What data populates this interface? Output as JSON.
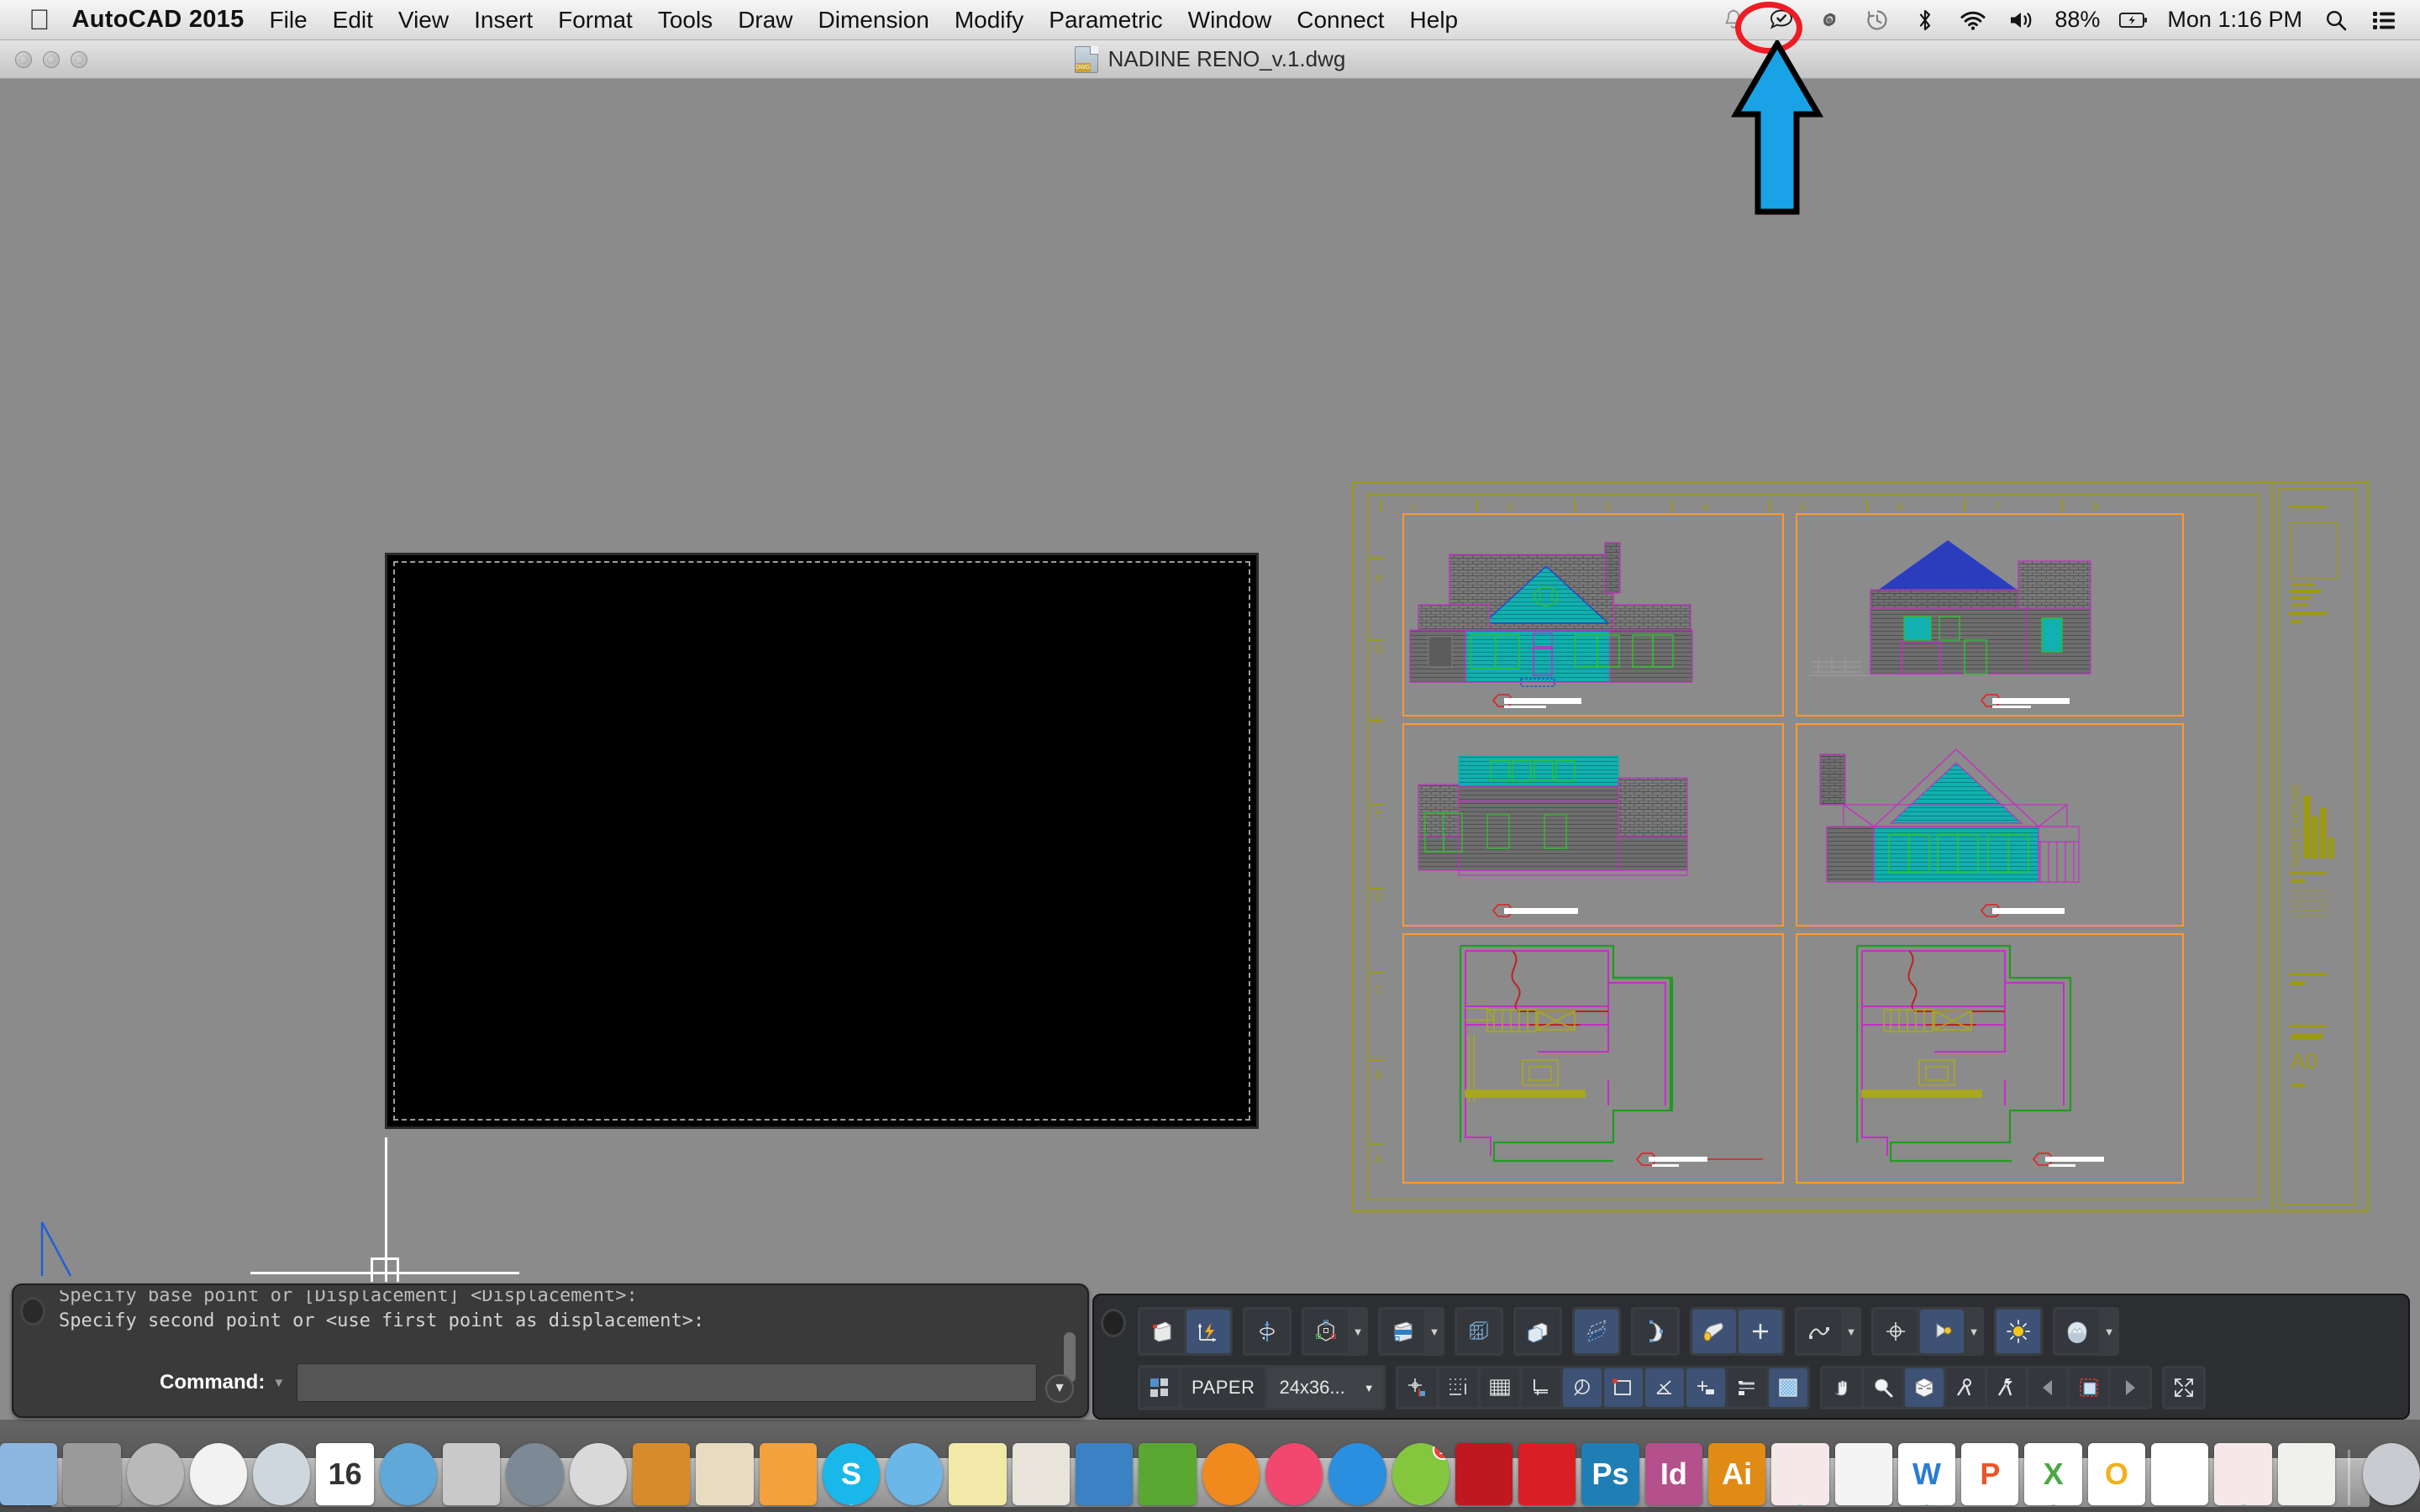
{
  "menubar": {
    "apple_icon": "apple-logo-icon",
    "app_name": "AutoCAD 2015",
    "menus": [
      "File",
      "Edit",
      "View",
      "Insert",
      "Format",
      "Tools",
      "Draw",
      "Dimension",
      "Modify",
      "Parametric",
      "Window",
      "Connect",
      "Help"
    ],
    "status_icons": [
      "bell-icon",
      "checkmark-badge-icon",
      "dropbox-spiral-icon",
      "time-machine-icon",
      "bluetooth-icon",
      "wifi-icon",
      "volume-icon"
    ],
    "battery_percent": "88%",
    "battery_icon": "battery-charging-icon",
    "clock": "Mon 1:16 PM",
    "search_icon": "spotlight-search-icon",
    "notification_icon": "notification-center-icon"
  },
  "window": {
    "title": "NADINE RENO_v.1.dwg",
    "file_icon": "dwg-file-icon",
    "file_icon_label": "DWG",
    "traffic_lights": [
      "close-button",
      "minimize-button",
      "zoom-button"
    ]
  },
  "command_window": {
    "history": [
      "Specify base point or [Displacement] <Displacement>:",
      "Specify second point or <use first point as displacement>:"
    ],
    "prompt_label": "Command:",
    "input_value": "",
    "input_placeholder": ""
  },
  "status_bar": {
    "row1": [
      {
        "name": "workspace-3d-solid-icon",
        "active": false
      },
      {
        "name": "dynamic-ucs-icon",
        "active": true
      },
      {
        "name": "revolve-icon",
        "active": false
      },
      {
        "name": "3d-object-snap-icon",
        "active": false,
        "dropdown": true
      },
      {
        "name": "visual-style-icon",
        "active": false,
        "dropdown": true
      },
      {
        "name": "wireframe-icon",
        "active": false
      },
      {
        "name": "solid-box-icon",
        "active": false
      },
      {
        "name": "section-plane-icon",
        "active": true
      },
      {
        "name": "surface-curve-icon",
        "active": false
      },
      {
        "name": "cylinder-icon",
        "active": true
      },
      {
        "name": "union-icon",
        "active": true
      },
      {
        "name": "mesh-icon",
        "active": false
      },
      {
        "name": "gizmo-icon",
        "active": false
      },
      {
        "name": "light-icon",
        "active": true
      },
      {
        "name": "sun-status-icon",
        "active": true
      },
      {
        "name": "sky-background-icon",
        "active": false,
        "dropdown": true
      }
    ],
    "layout_toggle_icon": "model-paper-toggle-icon",
    "space_label": "PAPER",
    "viewport_scale_label": "24x36...",
    "viewport_scale_dropdown_icon": "chevron-down-icon",
    "row2": [
      {
        "name": "osnap-icon",
        "active": false
      },
      {
        "name": "snap-mode-icon",
        "active": false
      },
      {
        "name": "grid-display-icon",
        "active": false
      },
      {
        "name": "ortho-mode-icon",
        "active": false
      },
      {
        "name": "polar-tracking-icon",
        "active": true
      },
      {
        "name": "object-snap-icon",
        "active": true
      },
      {
        "name": "object-snap-tracking-icon",
        "active": true
      },
      {
        "name": "dynamic-input-icon",
        "active": true
      },
      {
        "name": "lineweight-icon",
        "active": false
      },
      {
        "name": "transparency-icon",
        "active": true
      },
      {
        "name": "pan-icon",
        "active": false
      },
      {
        "name": "zoom-icon",
        "active": false
      },
      {
        "name": "viewcube-icon",
        "active": true
      },
      {
        "name": "steering-wheel-icon",
        "active": false
      },
      {
        "name": "quick-properties-icon",
        "active": false
      },
      {
        "name": "previous-arrow-icon",
        "active": false
      },
      {
        "name": "annotation-visibility-icon",
        "active": false
      },
      {
        "name": "next-arrow-icon",
        "active": false
      },
      {
        "name": "clean-screen-icon",
        "active": false
      }
    ]
  },
  "drawing": {
    "sheet_number": "A0",
    "project_title": "NADINE HOUSE",
    "grid_columns": [
      "1",
      "2",
      "3",
      "4",
      "5",
      "6",
      "7",
      "8"
    ],
    "grid_rows": [
      "A",
      "B",
      "C",
      "D",
      "E",
      "F",
      "G",
      "H"
    ],
    "viewports": [
      {
        "name": "front-elevation",
        "type": "elevation"
      },
      {
        "name": "right-elevation",
        "type": "elevation"
      },
      {
        "name": "rear-elevation",
        "type": "elevation"
      },
      {
        "name": "left-elevation",
        "type": "elevation"
      },
      {
        "name": "ground-floor-plan",
        "type": "plan"
      },
      {
        "name": "upper-floor-plan",
        "type": "plan"
      }
    ],
    "colors": {
      "sheet_border": "#9c9a17",
      "viewport_border": "#ff9933",
      "siding_teal": "#12b0b0",
      "roof_gray": "#6e6e6e",
      "trim_magenta": "#c42fc4",
      "window_green": "#2fbf2f",
      "plan_green": "#1f9c1f",
      "plan_yellow": "#a8a81e",
      "plan_red": "#bb2222",
      "callout_red": "#e02020"
    }
  },
  "annotation": {
    "highlight_shape": "red-ellipse-highlight",
    "highlight_color": "#ee1c25",
    "arrow_shape": "blue-up-arrow",
    "arrow_color": "#19a3e6",
    "target_icon": "dropbox-spiral-icon"
  },
  "dock": {
    "items": [
      {
        "name": "finder",
        "glyph": "",
        "bg": "#8cb6e0",
        "running": true
      },
      {
        "name": "system-preferences",
        "glyph": "",
        "bg": "#9a9a9a",
        "running": false
      },
      {
        "name": "launchpad",
        "glyph": "",
        "bg": "#b9b9b9",
        "running": false
      },
      {
        "name": "google-chrome",
        "glyph": "",
        "bg": "#f2f2f2",
        "running": true
      },
      {
        "name": "safari",
        "glyph": "",
        "bg": "#cfd7de",
        "running": false
      },
      {
        "name": "calendar",
        "glyph": "16",
        "bg": "#ffffff",
        "running": false
      },
      {
        "name": "iphoto",
        "glyph": "",
        "bg": "#5fa8d8",
        "running": false
      },
      {
        "name": "image-capture",
        "glyph": "",
        "bg": "#c9c9c9",
        "running": false
      },
      {
        "name": "facetime",
        "glyph": "",
        "bg": "#7d8a95",
        "running": false
      },
      {
        "name": "calculator",
        "glyph": "",
        "bg": "#d9d9d9",
        "running": false
      },
      {
        "name": "ilife-suite",
        "glyph": "",
        "bg": "#d88b2a",
        "running": false
      },
      {
        "name": "stickies-notes",
        "glyph": "",
        "bg": "#e7dcc0",
        "running": false
      },
      {
        "name": "pages",
        "glyph": "",
        "bg": "#f2a13c",
        "running": false
      },
      {
        "name": "skype",
        "glyph": "S",
        "bg": "#1ab7ea",
        "running": true
      },
      {
        "name": "messages",
        "glyph": "",
        "bg": "#6bb7e8",
        "running": false
      },
      {
        "name": "stickies",
        "glyph": "",
        "bg": "#f2e8a8",
        "running": false
      },
      {
        "name": "maps",
        "glyph": "",
        "bg": "#e9e4da",
        "running": false
      },
      {
        "name": "keynote",
        "glyph": "",
        "bg": "#3b82c4",
        "running": false
      },
      {
        "name": "numbers",
        "glyph": "",
        "bg": "#5aa832",
        "running": false
      },
      {
        "name": "ibooks",
        "glyph": "",
        "bg": "#f08a1e",
        "running": false
      },
      {
        "name": "itunes",
        "glyph": "",
        "bg": "#f2486f",
        "running": false
      },
      {
        "name": "app-store",
        "glyph": "",
        "bg": "#2b8fe0",
        "running": false
      },
      {
        "name": "spotify",
        "glyph": "",
        "bg": "#84c73f",
        "running": true,
        "badge": "1"
      },
      {
        "name": "adobe-creative-cloud",
        "glyph": "",
        "bg": "#c0181f",
        "running": false
      },
      {
        "name": "adobe-acrobat",
        "glyph": "",
        "bg": "#d81f26",
        "running": false
      },
      {
        "name": "adobe-photoshop",
        "glyph": "Ps",
        "bg": "#1f7fb5",
        "running": false
      },
      {
        "name": "adobe-indesign",
        "glyph": "Id",
        "bg": "#b4508b",
        "running": false
      },
      {
        "name": "adobe-illustrator",
        "glyph": "Ai",
        "bg": "#e08b15",
        "running": false
      },
      {
        "name": "autocad",
        "glyph": "",
        "bg": "#f6e8e8",
        "running": true
      },
      {
        "name": "adobe-reader",
        "glyph": "",
        "bg": "#f4f4f4",
        "running": false
      },
      {
        "name": "microsoft-word",
        "glyph": "W",
        "bg": "#ffffff",
        "running": true
      },
      {
        "name": "microsoft-powerpoint",
        "glyph": "P",
        "bg": "#ffffff",
        "running": false
      },
      {
        "name": "microsoft-excel",
        "glyph": "X",
        "bg": "#ffffff",
        "running": true
      },
      {
        "name": "microsoft-outlook",
        "glyph": "O",
        "bg": "#ffffff",
        "running": false
      },
      {
        "name": "adobe-acrobat-update",
        "glyph": "",
        "bg": "#ffffff",
        "running": false
      },
      {
        "name": "autocad-2015",
        "glyph": "",
        "bg": "#f6e8e8",
        "running": true
      },
      {
        "name": "downloads-folder",
        "glyph": "",
        "bg": "#f0f0ec",
        "running": false
      },
      {
        "name": "trash",
        "glyph": "",
        "bg": "#c8ccd0",
        "running": false
      }
    ]
  }
}
